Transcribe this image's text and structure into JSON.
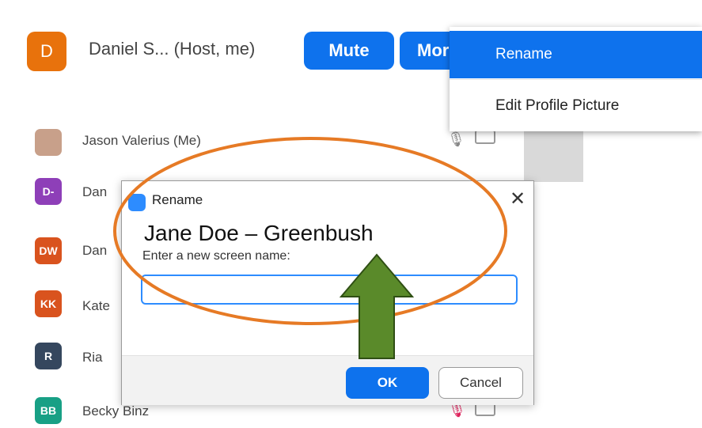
{
  "host": {
    "avatar_initial": "D",
    "name": "Daniel S... (Host, me)",
    "mute_label": "Mute",
    "more_label": "More"
  },
  "participants": [
    {
      "initials": "",
      "name": "Jason Valerius (Me)",
      "color": "#c8a08a"
    },
    {
      "initials": "D-",
      "name": "Dan",
      "color": "#8e3fb8"
    },
    {
      "initials": "DW",
      "name": "Dan",
      "color": "#d9531e"
    },
    {
      "initials": "KK",
      "name": "Kate",
      "color": "#d9531e"
    },
    {
      "initials": "R",
      "name": "Ria",
      "color": "#35475e"
    },
    {
      "initials": "BB",
      "name": "Becky Binz",
      "color": "#18a085"
    }
  ],
  "context_menu": {
    "items": [
      "Rename",
      "Edit Profile Picture"
    ]
  },
  "dialog": {
    "title": "Rename",
    "close_glyph": "✕",
    "new_name_example": "Jane Doe – Greenbush",
    "prompt": "Enter a new screen name:",
    "input_value": "",
    "ok_label": "OK",
    "cancel_label": "Cancel"
  },
  "colors": {
    "accent_blue": "#0e72ed",
    "annotation_orange": "#e67a25",
    "arrow_green": "#5a8a2a"
  }
}
